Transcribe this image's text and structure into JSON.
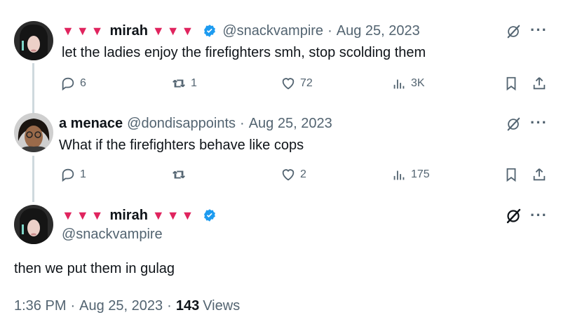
{
  "tweets": [
    {
      "display_name": "mirah",
      "hearts_before": "▼▼▼",
      "hearts_after": "▼▼▼",
      "handle": "@snackvampire",
      "separator": "·",
      "date": "Aug 25, 2023",
      "text": "let the ladies enjoy the firefighters smh, stop scolding them",
      "replies": "6",
      "retweets": "1",
      "likes": "72",
      "views": "3K"
    },
    {
      "display_name": "a menace",
      "handle": "@dondisappoints",
      "separator": "·",
      "date": "Aug 25, 2023",
      "text": "What if the firefighters behave like cops",
      "replies": "1",
      "retweets": "",
      "likes": "2",
      "views": "175"
    }
  ],
  "main_tweet": {
    "display_name": "mirah",
    "hearts_before": "▼▼▼",
    "hearts_after": "▼▼▼",
    "handle": "@snackvampire",
    "text": "then we put them in gulag",
    "time": "1:36 PM",
    "separator": "·",
    "date": "Aug 25, 2023",
    "views_count": "143",
    "views_label": "Views"
  },
  "icons": {
    "more": "more-icon",
    "grok": "grok-icon",
    "verified": "verified-badge-icon"
  },
  "colors": {
    "verified": "#1d9bf0",
    "hearts": "#e0245e",
    "muted": "#536471"
  }
}
